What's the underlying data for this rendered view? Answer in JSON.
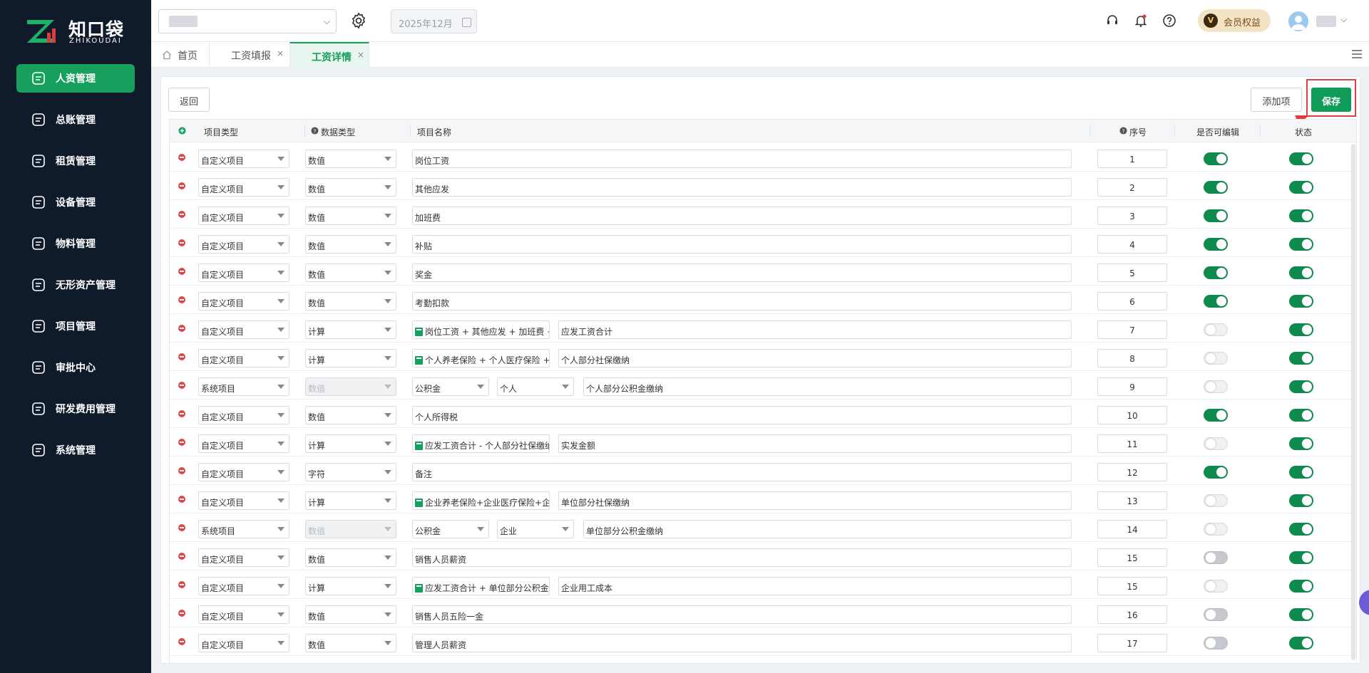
{
  "sidebar": {
    "logo_cn": "知口袋",
    "logo_en": "ZHIKOUDAI",
    "items": [
      {
        "label": "人资管理",
        "icon": "person-icon",
        "active": true
      },
      {
        "label": "总账管理",
        "icon": "ledger-icon"
      },
      {
        "label": "租赁管理",
        "icon": "lease-icon"
      },
      {
        "label": "设备管理",
        "icon": "device-icon"
      },
      {
        "label": "物料管理",
        "icon": "material-icon"
      },
      {
        "label": "无形资产管理",
        "icon": "intangible-asset-icon"
      },
      {
        "label": "项目管理",
        "icon": "project-icon"
      },
      {
        "label": "审批中心",
        "icon": "approval-icon"
      },
      {
        "label": "研发费用管理",
        "icon": "rd-cost-icon"
      },
      {
        "label": "系统管理",
        "icon": "gear-icon"
      }
    ]
  },
  "topbar": {
    "date_value": "2025年12月",
    "vip_label": "会员权益",
    "vip_badge": "V"
  },
  "tabs": [
    {
      "label": "首页"
    },
    {
      "label": "工资填报",
      "close": "×"
    },
    {
      "label": "工资详情",
      "close": "×",
      "active": true
    }
  ],
  "toolbar": {
    "back_label": "返回",
    "add_label": "添加项",
    "save_label": "保存"
  },
  "table": {
    "headers": {
      "item_type": "项目类型",
      "data_type": "数据类型",
      "item_name": "项目名称",
      "seq": "序号",
      "editable": "是否可编辑",
      "status": "状态"
    },
    "rows": [
      {
        "item_type": "自定义项目",
        "data_type": "数值",
        "name": "岗位工资",
        "seq": "1",
        "editable": true,
        "status": true
      },
      {
        "item_type": "自定义项目",
        "data_type": "数值",
        "name": "其他应发",
        "seq": "2",
        "editable": true,
        "status": true
      },
      {
        "item_type": "自定义项目",
        "data_type": "数值",
        "name": "加班费",
        "seq": "3",
        "editable": true,
        "status": true
      },
      {
        "item_type": "自定义项目",
        "data_type": "数值",
        "name": "补贴",
        "seq": "4",
        "editable": true,
        "status": true
      },
      {
        "item_type": "自定义项目",
        "data_type": "数值",
        "name": "奖金",
        "seq": "5",
        "editable": true,
        "status": true
      },
      {
        "item_type": "自定义项目",
        "data_type": "数值",
        "name": "考勤扣款",
        "seq": "6",
        "editable": true,
        "status": true
      },
      {
        "item_type": "自定义项目",
        "data_type": "计算",
        "formula": "岗位工资 + 其他应发 + 加班费 +",
        "name": "应发工资合计",
        "seq": "7",
        "editable": false,
        "status": true
      },
      {
        "item_type": "自定义项目",
        "data_type": "计算",
        "formula": "个人养老保险 + 个人医疗保险 +",
        "name": "个人部分社保缴纳",
        "seq": "8",
        "editable": false,
        "status": true
      },
      {
        "item_type": "系统项目",
        "data_type": "数值",
        "sys1": "公积金",
        "sys2": "个人",
        "name": "个人部分公积金缴纳",
        "seq": "9",
        "editable": false,
        "status": true
      },
      {
        "item_type": "自定义项目",
        "data_type": "数值",
        "name": "个人所得税",
        "seq": "10",
        "editable": true,
        "status": true
      },
      {
        "item_type": "自定义项目",
        "data_type": "计算",
        "formula": "应发工资合计 - 个人部分社保缴纳",
        "name": "实发金额",
        "seq": "11",
        "editable": false,
        "status": true
      },
      {
        "item_type": "自定义项目",
        "data_type": "字符",
        "name": "备注",
        "seq": "12",
        "editable": true,
        "status": true
      },
      {
        "item_type": "自定义项目",
        "data_type": "计算",
        "formula": "企业养老保险+企业医疗保险+企",
        "name": "单位部分社保缴纳",
        "seq": "13",
        "editable": false,
        "status": true
      },
      {
        "item_type": "系统项目",
        "data_type": "数值",
        "sys1": "公积金",
        "sys2": "企业",
        "name": "单位部分公积金缴纳",
        "seq": "14",
        "editable": false,
        "status": true
      },
      {
        "item_type": "自定义项目",
        "data_type": "数值",
        "name": "销售人员薪资",
        "seq": "15",
        "editable": "grey",
        "status": true
      },
      {
        "item_type": "自定义项目",
        "data_type": "计算",
        "formula": "应发工资合计 + 单位部分公积金",
        "name": "企业用工成本",
        "seq": "15",
        "editable": false,
        "status": true
      },
      {
        "item_type": "自定义项目",
        "data_type": "数值",
        "name": "销售人员五险一金",
        "seq": "16",
        "editable": "grey",
        "status": true
      },
      {
        "item_type": "自定义项目",
        "data_type": "数值",
        "name": "管理人员薪资",
        "seq": "17",
        "editable": "grey",
        "status": true
      }
    ]
  },
  "colors": {
    "brand": "#17a05d",
    "sidebar": "#0f1a2b",
    "danger": "#e04848"
  }
}
